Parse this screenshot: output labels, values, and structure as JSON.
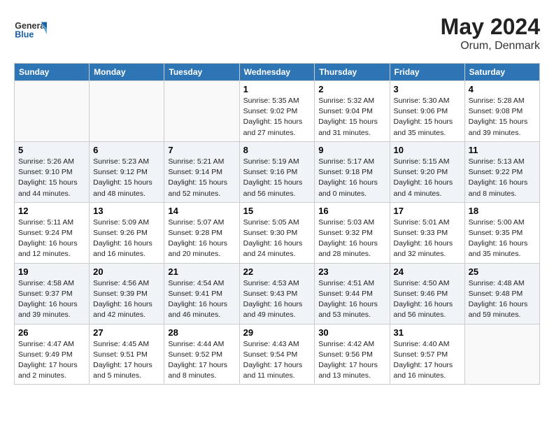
{
  "header": {
    "logo_general": "General",
    "logo_blue": "Blue",
    "month_year": "May 2024",
    "location": "Orum, Denmark"
  },
  "days_of_week": [
    "Sunday",
    "Monday",
    "Tuesday",
    "Wednesday",
    "Thursday",
    "Friday",
    "Saturday"
  ],
  "weeks": [
    [
      {
        "day": "",
        "info": ""
      },
      {
        "day": "",
        "info": ""
      },
      {
        "day": "",
        "info": ""
      },
      {
        "day": "1",
        "info": "Sunrise: 5:35 AM\nSunset: 9:02 PM\nDaylight: 15 hours\nand 27 minutes."
      },
      {
        "day": "2",
        "info": "Sunrise: 5:32 AM\nSunset: 9:04 PM\nDaylight: 15 hours\nand 31 minutes."
      },
      {
        "day": "3",
        "info": "Sunrise: 5:30 AM\nSunset: 9:06 PM\nDaylight: 15 hours\nand 35 minutes."
      },
      {
        "day": "4",
        "info": "Sunrise: 5:28 AM\nSunset: 9:08 PM\nDaylight: 15 hours\nand 39 minutes."
      }
    ],
    [
      {
        "day": "5",
        "info": "Sunrise: 5:26 AM\nSunset: 9:10 PM\nDaylight: 15 hours\nand 44 minutes."
      },
      {
        "day": "6",
        "info": "Sunrise: 5:23 AM\nSunset: 9:12 PM\nDaylight: 15 hours\nand 48 minutes."
      },
      {
        "day": "7",
        "info": "Sunrise: 5:21 AM\nSunset: 9:14 PM\nDaylight: 15 hours\nand 52 minutes."
      },
      {
        "day": "8",
        "info": "Sunrise: 5:19 AM\nSunset: 9:16 PM\nDaylight: 15 hours\nand 56 minutes."
      },
      {
        "day": "9",
        "info": "Sunrise: 5:17 AM\nSunset: 9:18 PM\nDaylight: 16 hours\nand 0 minutes."
      },
      {
        "day": "10",
        "info": "Sunrise: 5:15 AM\nSunset: 9:20 PM\nDaylight: 16 hours\nand 4 minutes."
      },
      {
        "day": "11",
        "info": "Sunrise: 5:13 AM\nSunset: 9:22 PM\nDaylight: 16 hours\nand 8 minutes."
      }
    ],
    [
      {
        "day": "12",
        "info": "Sunrise: 5:11 AM\nSunset: 9:24 PM\nDaylight: 16 hours\nand 12 minutes."
      },
      {
        "day": "13",
        "info": "Sunrise: 5:09 AM\nSunset: 9:26 PM\nDaylight: 16 hours\nand 16 minutes."
      },
      {
        "day": "14",
        "info": "Sunrise: 5:07 AM\nSunset: 9:28 PM\nDaylight: 16 hours\nand 20 minutes."
      },
      {
        "day": "15",
        "info": "Sunrise: 5:05 AM\nSunset: 9:30 PM\nDaylight: 16 hours\nand 24 minutes."
      },
      {
        "day": "16",
        "info": "Sunrise: 5:03 AM\nSunset: 9:32 PM\nDaylight: 16 hours\nand 28 minutes."
      },
      {
        "day": "17",
        "info": "Sunrise: 5:01 AM\nSunset: 9:33 PM\nDaylight: 16 hours\nand 32 minutes."
      },
      {
        "day": "18",
        "info": "Sunrise: 5:00 AM\nSunset: 9:35 PM\nDaylight: 16 hours\nand 35 minutes."
      }
    ],
    [
      {
        "day": "19",
        "info": "Sunrise: 4:58 AM\nSunset: 9:37 PM\nDaylight: 16 hours\nand 39 minutes."
      },
      {
        "day": "20",
        "info": "Sunrise: 4:56 AM\nSunset: 9:39 PM\nDaylight: 16 hours\nand 42 minutes."
      },
      {
        "day": "21",
        "info": "Sunrise: 4:54 AM\nSunset: 9:41 PM\nDaylight: 16 hours\nand 46 minutes."
      },
      {
        "day": "22",
        "info": "Sunrise: 4:53 AM\nSunset: 9:43 PM\nDaylight: 16 hours\nand 49 minutes."
      },
      {
        "day": "23",
        "info": "Sunrise: 4:51 AM\nSunset: 9:44 PM\nDaylight: 16 hours\nand 53 minutes."
      },
      {
        "day": "24",
        "info": "Sunrise: 4:50 AM\nSunset: 9:46 PM\nDaylight: 16 hours\nand 56 minutes."
      },
      {
        "day": "25",
        "info": "Sunrise: 4:48 AM\nSunset: 9:48 PM\nDaylight: 16 hours\nand 59 minutes."
      }
    ],
    [
      {
        "day": "26",
        "info": "Sunrise: 4:47 AM\nSunset: 9:49 PM\nDaylight: 17 hours\nand 2 minutes."
      },
      {
        "day": "27",
        "info": "Sunrise: 4:45 AM\nSunset: 9:51 PM\nDaylight: 17 hours\nand 5 minutes."
      },
      {
        "day": "28",
        "info": "Sunrise: 4:44 AM\nSunset: 9:52 PM\nDaylight: 17 hours\nand 8 minutes."
      },
      {
        "day": "29",
        "info": "Sunrise: 4:43 AM\nSunset: 9:54 PM\nDaylight: 17 hours\nand 11 minutes."
      },
      {
        "day": "30",
        "info": "Sunrise: 4:42 AM\nSunset: 9:56 PM\nDaylight: 17 hours\nand 13 minutes."
      },
      {
        "day": "31",
        "info": "Sunrise: 4:40 AM\nSunset: 9:57 PM\nDaylight: 17 hours\nand 16 minutes."
      },
      {
        "day": "",
        "info": ""
      }
    ]
  ]
}
